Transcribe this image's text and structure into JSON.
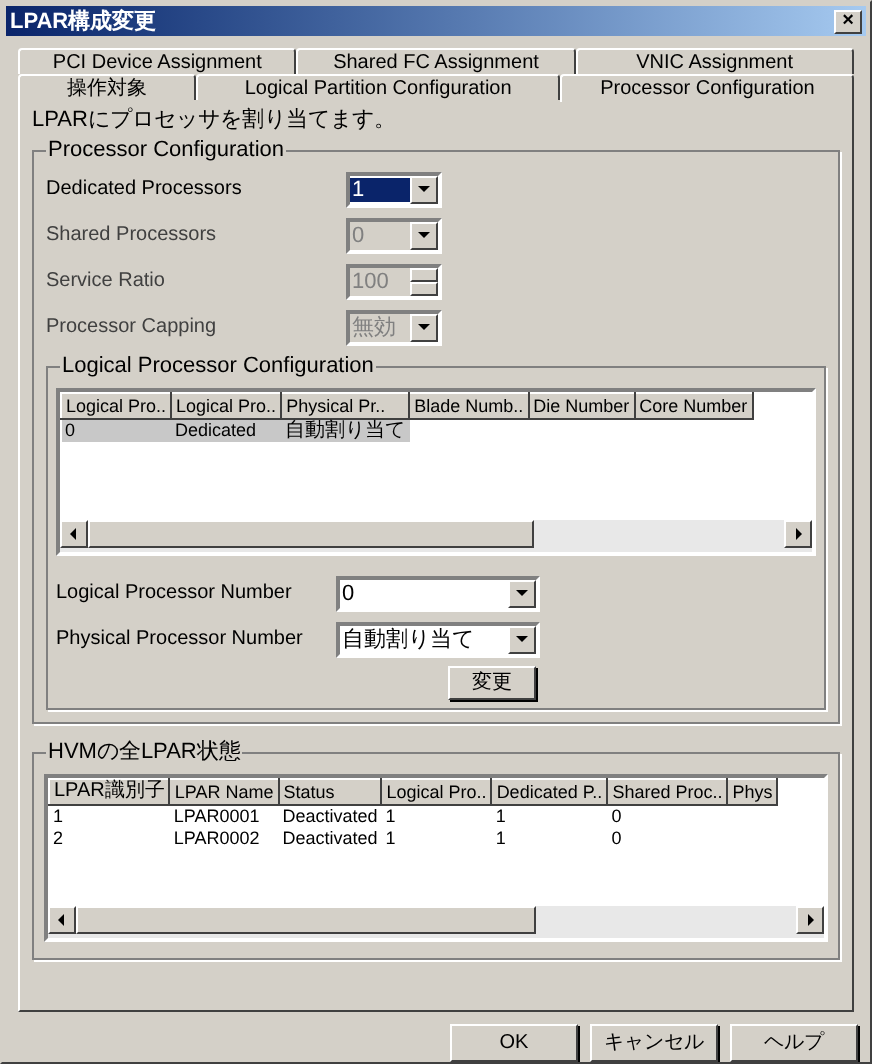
{
  "window": {
    "title": "LPAR構成変更",
    "close": "×"
  },
  "tab_rows": [
    {
      "tabs": [
        {
          "label": "PCI Device Assignment",
          "selected": false
        },
        {
          "label": "Shared FC Assignment",
          "selected": false
        },
        {
          "label": "VNIC Assignment",
          "selected": false
        }
      ]
    },
    {
      "tabs": [
        {
          "label": "操作対象",
          "selected": false
        },
        {
          "label": "Logical Partition Configuration",
          "selected": false
        },
        {
          "label": "Processor Configuration",
          "selected": true
        }
      ]
    }
  ],
  "description": "LPARにプロセッサを割り当てます。",
  "processor_group": {
    "title": "Processor Configuration",
    "fields": [
      {
        "label": "Dedicated Processors",
        "value": "1",
        "kind": "combo",
        "disabled": false,
        "focused": true
      },
      {
        "label": "Shared Processors",
        "value": "0",
        "kind": "combo",
        "disabled": true,
        "focused": false
      },
      {
        "label": "Service Ratio",
        "value": "100",
        "kind": "spin",
        "disabled": true,
        "focused": false
      },
      {
        "label": "Processor Capping",
        "value": "無効",
        "kind": "combo",
        "disabled": true,
        "focused": false
      }
    ]
  },
  "logical_group": {
    "title": "Logical Processor Configuration",
    "table": {
      "columns": [
        "Logical Pro..",
        "Logical Pro..",
        "Physical Pr..",
        "Blade Numb..",
        "Die Number",
        "Core Number"
      ],
      "rows": [
        {
          "cells": [
            "0",
            "Dedicated",
            "自動割り当て"
          ],
          "selected": true
        }
      ]
    },
    "fields": [
      {
        "label": "Logical Processor Number",
        "value": "0"
      },
      {
        "label": "Physical Processor Number",
        "value": "自動割り当て"
      }
    ],
    "button": "変更"
  },
  "hvm_group": {
    "title": "HVMの全LPAR状態",
    "table": {
      "columns": [
        "LPAR識別子",
        "LPAR Name",
        "Status",
        "Logical Pro..",
        "Dedicated P..",
        "Shared Proc..",
        "Phys"
      ],
      "rows": [
        {
          "cells": [
            "1",
            "LPAR0001",
            "Deactivated",
            "1",
            "1",
            "0"
          ],
          "selected": false
        },
        {
          "cells": [
            "2",
            "LPAR0002",
            "Deactivated",
            "1",
            "1",
            "0"
          ],
          "selected": false
        }
      ]
    }
  },
  "buttons": [
    "OK",
    "キャンセル",
    "ヘルプ"
  ]
}
